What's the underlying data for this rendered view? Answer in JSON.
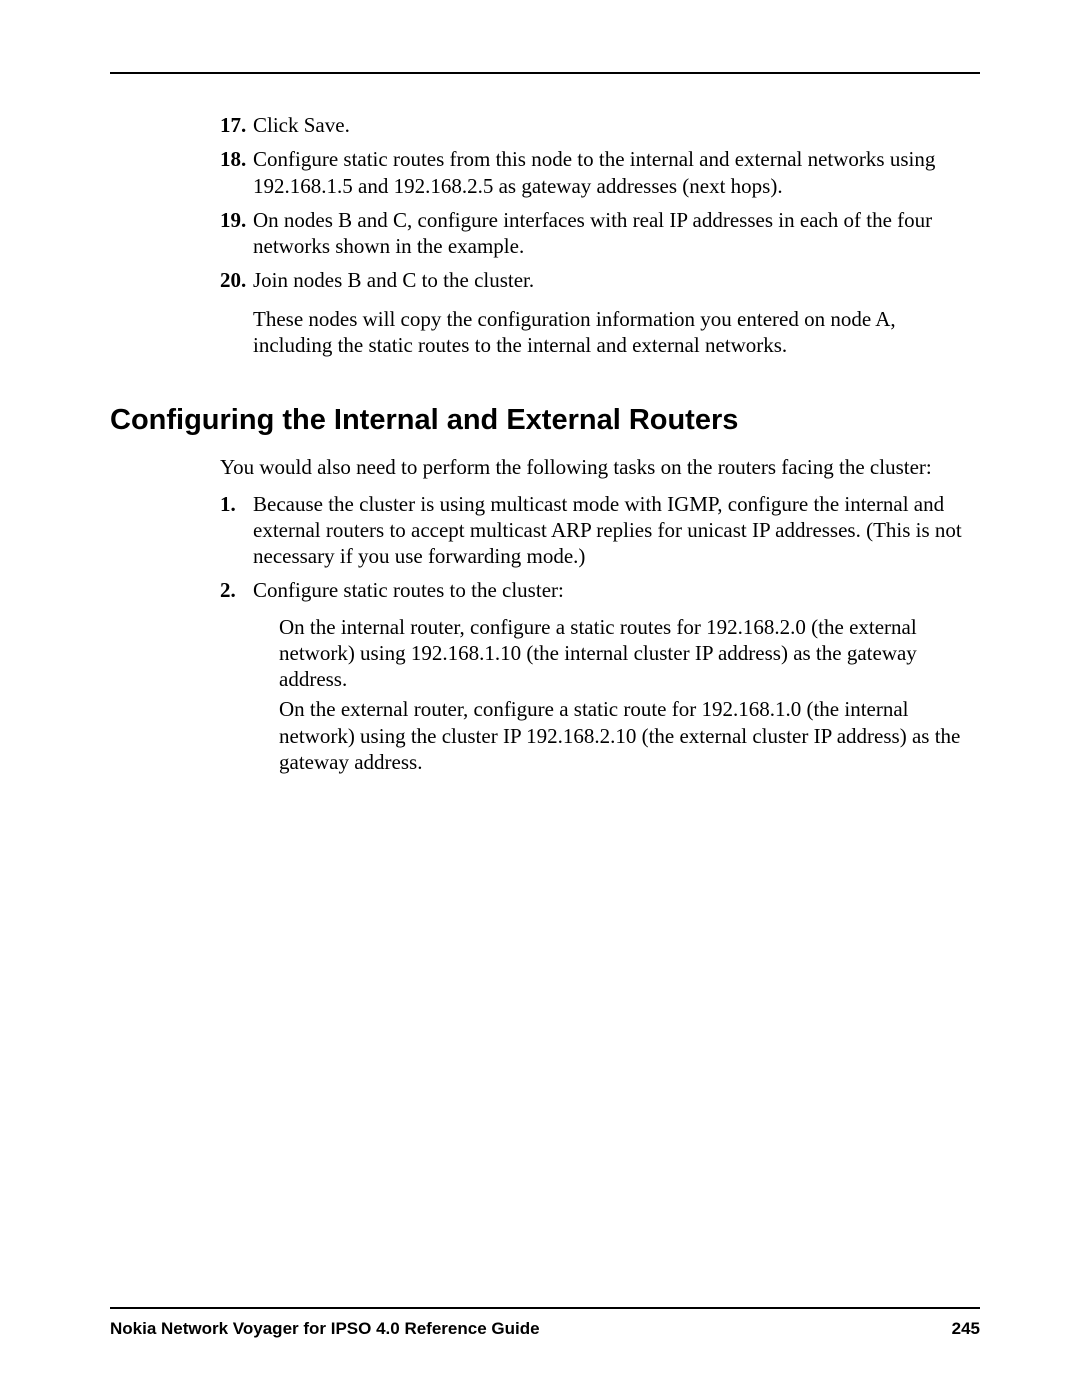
{
  "steps": [
    {
      "num": "17.",
      "text": "Click Save."
    },
    {
      "num": "18.",
      "text": "Configure static routes from this node to the internal and external networks using 192.168.1.5 and 192.168.2.5 as gateway addresses (next hops)."
    },
    {
      "num": "19.",
      "text": "On nodes B and C, configure interfaces with real IP addresses in each of the four networks shown in the example."
    },
    {
      "num": "20.",
      "text": "Join nodes B and C to the cluster."
    }
  ],
  "step20_note": "These nodes will copy the configuration information you entered on node A, including the static routes to the internal and external networks.",
  "section_heading": "Configuring the Internal and External Routers",
  "intro": "You would also need to perform the following tasks on the routers facing the cluster:",
  "tasks": [
    {
      "num": "1.",
      "text": "Because the cluster is using multicast mode with IGMP, configure the internal and external routers to accept multicast ARP replies for unicast IP addresses. (This is not necessary if you use forwarding mode.)"
    },
    {
      "num": "2.",
      "text": "Configure static routes to the cluster:"
    }
  ],
  "task2_sub": [
    "On the internal router, configure a static routes for 192.168.2.0 (the external network) using 192.168.1.10 (the internal cluster IP address) as the gateway address.",
    "On the external router, configure a static route for 192.168.1.0 (the internal network) using the cluster IP 192.168.2.10 (the external cluster IP address) as the gateway address."
  ],
  "footer": {
    "title": "Nokia Network Voyager for IPSO 4.0 Reference Guide",
    "page": "245"
  }
}
